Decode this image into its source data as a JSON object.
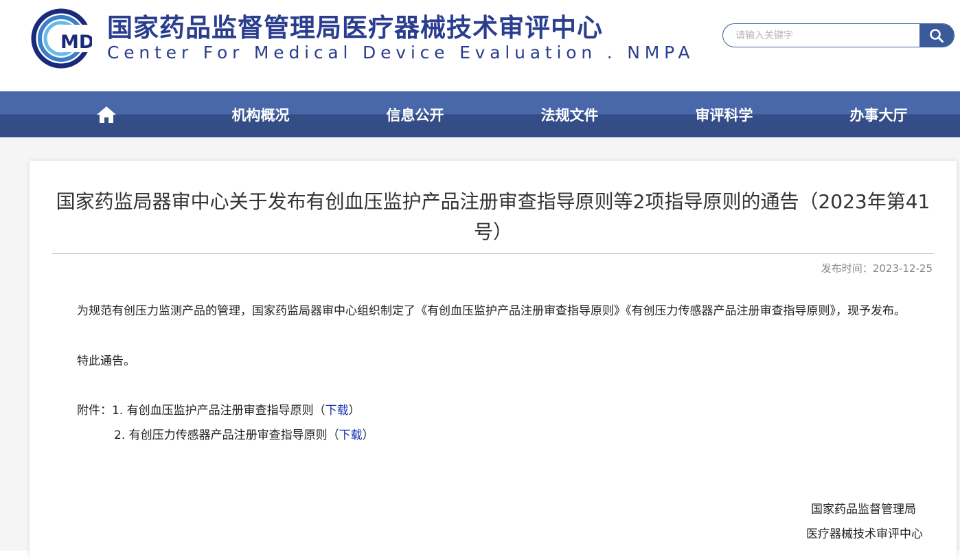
{
  "header": {
    "logo_text": "MDE",
    "title_cn": "国家药品监督管理局医疗器械技术审评中心",
    "title_en": "Center For Medical Device Evaluation . NMPA",
    "brand_color": "#2a3d8f"
  },
  "search": {
    "placeholder": "请输入关键字",
    "value": "",
    "icon": "search-icon"
  },
  "nav": {
    "items": [
      {
        "label": "",
        "icon": "home-icon"
      },
      {
        "label": "机构概况"
      },
      {
        "label": "信息公开"
      },
      {
        "label": "法规文件"
      },
      {
        "label": "审评科学"
      },
      {
        "label": "办事大厅"
      }
    ],
    "color_top": "#4868aa",
    "color_bottom": "#344d86"
  },
  "article": {
    "title": "国家药监局器审中心关于发布有创血压监护产品注册审查指导原则等2项指导原则的通告（2023年第41号）",
    "publish_label": "发布时间：",
    "publish_date": "2023-12-25",
    "para1": "为规范有创压力监测产品的管理，国家药监局器审中心组织制定了《有创血压监护产品注册审查指导原则》《有创压力传感器产品注册审查指导原则》，现予发布。",
    "para2": "特此通告。",
    "attachment_label": "附件：",
    "attachments": [
      {
        "prefix": "1. 有创血压监护产品注册审查指导原则（",
        "link": "下载",
        "suffix": "）"
      },
      {
        "prefix": "2. 有创压力传感器产品注册审查指导原则（",
        "link": "下载",
        "suffix": "）"
      }
    ],
    "signature_1": "国家药品监督管理局",
    "signature_2": "医疗器械技术审评中心"
  }
}
